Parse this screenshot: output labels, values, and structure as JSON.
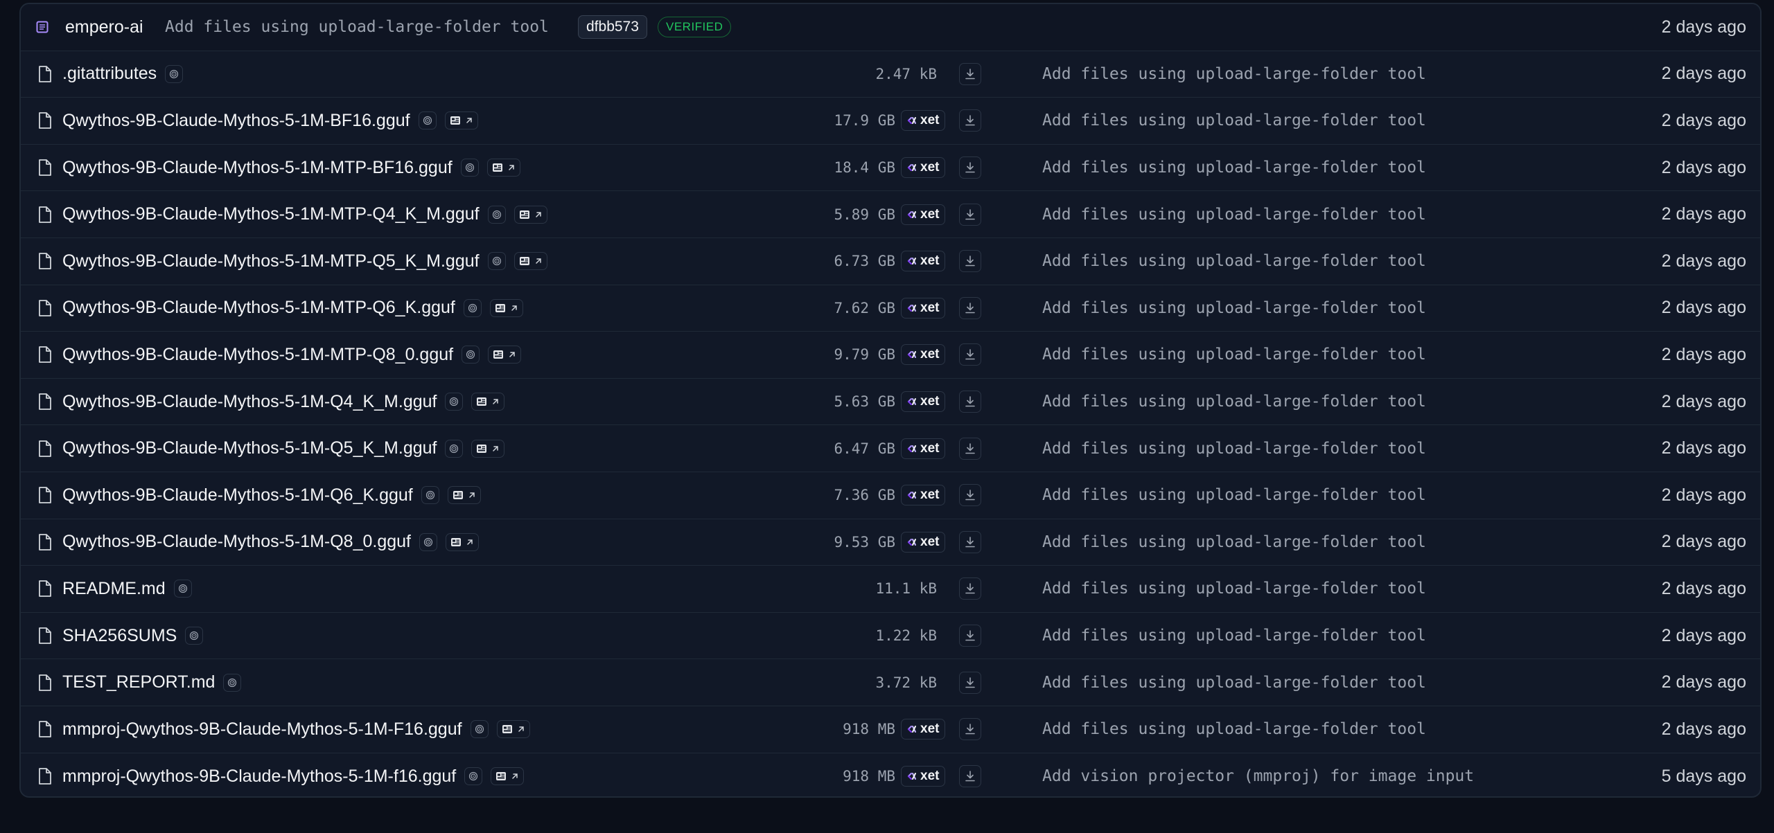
{
  "header": {
    "author": "empero-ai",
    "message": "Add files using upload-large-folder tool",
    "commit_hash": "dfbb573",
    "verified_label": "VERIFIED",
    "time": "2 days ago"
  },
  "xet_label": "xet",
  "files": [
    {
      "name": ".gitattributes",
      "gguf": false,
      "size": "2.47 kB",
      "xet": false,
      "message": "Add files using upload-large-folder tool",
      "time": "2 days ago"
    },
    {
      "name": "Qwythos-9B-Claude-Mythos-5-1M-BF16.gguf",
      "gguf": true,
      "size": "17.9 GB",
      "xet": true,
      "message": "Add files using upload-large-folder tool",
      "time": "2 days ago"
    },
    {
      "name": "Qwythos-9B-Claude-Mythos-5-1M-MTP-BF16.gguf",
      "gguf": true,
      "size": "18.4 GB",
      "xet": true,
      "message": "Add files using upload-large-folder tool",
      "time": "2 days ago"
    },
    {
      "name": "Qwythos-9B-Claude-Mythos-5-1M-MTP-Q4_K_M.gguf",
      "gguf": true,
      "size": "5.89 GB",
      "xet": true,
      "message": "Add files using upload-large-folder tool",
      "time": "2 days ago"
    },
    {
      "name": "Qwythos-9B-Claude-Mythos-5-1M-MTP-Q5_K_M.gguf",
      "gguf": true,
      "size": "6.73 GB",
      "xet": true,
      "message": "Add files using upload-large-folder tool",
      "time": "2 days ago"
    },
    {
      "name": "Qwythos-9B-Claude-Mythos-5-1M-MTP-Q6_K.gguf",
      "gguf": true,
      "size": "7.62 GB",
      "xet": true,
      "message": "Add files using upload-large-folder tool",
      "time": "2 days ago"
    },
    {
      "name": "Qwythos-9B-Claude-Mythos-5-1M-MTP-Q8_0.gguf",
      "gguf": true,
      "size": "9.79 GB",
      "xet": true,
      "message": "Add files using upload-large-folder tool",
      "time": "2 days ago"
    },
    {
      "name": "Qwythos-9B-Claude-Mythos-5-1M-Q4_K_M.gguf",
      "gguf": true,
      "size": "5.63 GB",
      "xet": true,
      "message": "Add files using upload-large-folder tool",
      "time": "2 days ago"
    },
    {
      "name": "Qwythos-9B-Claude-Mythos-5-1M-Q5_K_M.gguf",
      "gguf": true,
      "size": "6.47 GB",
      "xet": true,
      "message": "Add files using upload-large-folder tool",
      "time": "2 days ago"
    },
    {
      "name": "Qwythos-9B-Claude-Mythos-5-1M-Q6_K.gguf",
      "gguf": true,
      "size": "7.36 GB",
      "xet": true,
      "message": "Add files using upload-large-folder tool",
      "time": "2 days ago"
    },
    {
      "name": "Qwythos-9B-Claude-Mythos-5-1M-Q8_0.gguf",
      "gguf": true,
      "size": "9.53 GB",
      "xet": true,
      "message": "Add files using upload-large-folder tool",
      "time": "2 days ago"
    },
    {
      "name": "README.md",
      "gguf": false,
      "size": "11.1 kB",
      "xet": false,
      "message": "Add files using upload-large-folder tool",
      "time": "2 days ago"
    },
    {
      "name": "SHA256SUMS",
      "gguf": false,
      "size": "1.22 kB",
      "xet": false,
      "message": "Add files using upload-large-folder tool",
      "time": "2 days ago"
    },
    {
      "name": "TEST_REPORT.md",
      "gguf": false,
      "size": "3.72 kB",
      "xet": false,
      "message": "Add files using upload-large-folder tool",
      "time": "2 days ago"
    },
    {
      "name": "mmproj-Qwythos-9B-Claude-Mythos-5-1M-F16.gguf",
      "gguf": true,
      "size": "918 MB",
      "xet": true,
      "message": "Add files using upload-large-folder tool",
      "time": "2 days ago"
    },
    {
      "name": "mmproj-Qwythos-9B-Claude-Mythos-5-1M-f16.gguf",
      "gguf": true,
      "size": "918 MB",
      "xet": true,
      "message": "Add vision projector (mmproj) for image input",
      "time": "5 days ago"
    }
  ],
  "colors": {
    "background": "#0b0f19",
    "panel": "#111827",
    "verified": "#22c55e",
    "commit_icon": "#a78bfa",
    "xet_icon": "#a78bfa"
  }
}
